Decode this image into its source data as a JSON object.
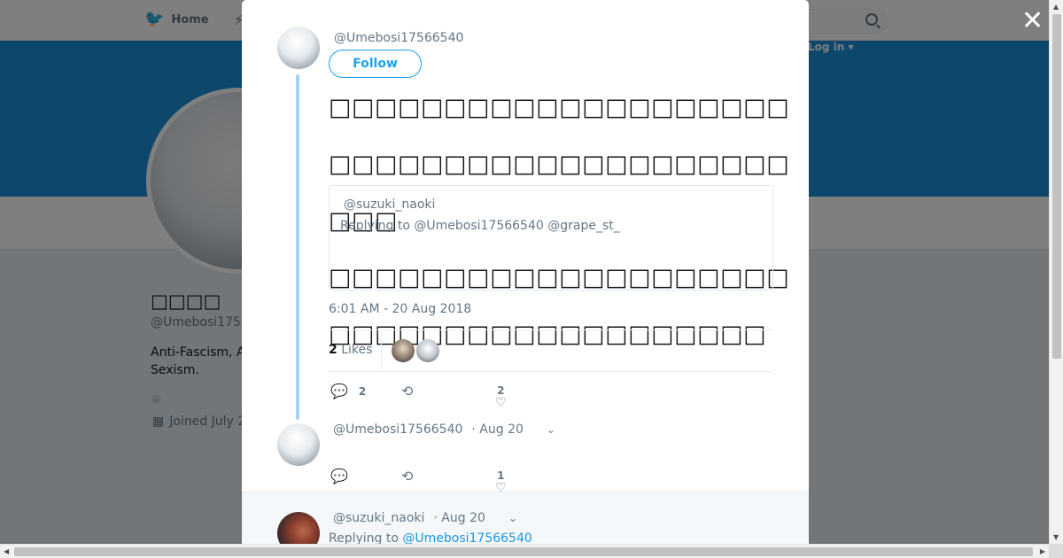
{
  "nav": {
    "home_label": "Home",
    "login_label": "Log in ▾"
  },
  "profile": {
    "name": "□□□□",
    "handle": "@Umebosi17566540",
    "bio": "Anti-Fascism, A... Sexism.",
    "bio_line1": "Anti-Fascism, A",
    "bio_line2": "Sexism.",
    "joined": "Joined July 2"
  },
  "tweet": {
    "author_handle": "@Umebosi17566540",
    "follow_label": "Follow",
    "text_line1": "□□□□□□□□□□□□□□□□□□□□□□□□□□□□□□□□□□□□□□□□□□□",
    "text_line2": "□□□□□□□□□□□□□□□□□□□□□□□□□□□□□□□□□□□□□□□",
    "quote": {
      "handle": "@suzuki_naoki",
      "replying": "Replying to @Umebosi17566540 @grape_st_"
    },
    "time": "6:01 AM - 20 Aug 2018",
    "likes_count": "2",
    "likes_label": "Likes",
    "actions": {
      "reply_count": "2",
      "like_count": "2"
    }
  },
  "replies": [
    {
      "handle": "@Umebosi17566540",
      "date": "· Aug 20",
      "like_count": "1"
    },
    {
      "handle": "@suzuki_naoki",
      "date": "· Aug 20",
      "replying_prefix": "Replying to",
      "replying_to": "@Umebosi17566540"
    }
  ],
  "colors": {
    "accent": "#1da1f2",
    "banner": "#1b8ed6",
    "thread_line": "#a7d3f2"
  }
}
